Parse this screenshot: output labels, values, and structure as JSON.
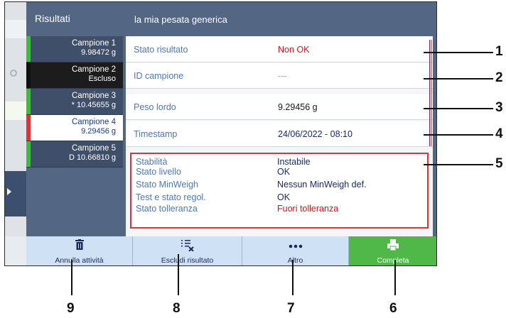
{
  "header": {
    "left_title": "Risultati",
    "right_title": "la mia pesata generica"
  },
  "samples": [
    {
      "name": "Campione 1",
      "value": "9.98472 g",
      "bar_color": "#3dbb3d",
      "state": "normal"
    },
    {
      "name": "Campione 2",
      "value": "Escluso",
      "bar_color": "#111111",
      "state": "excluded"
    },
    {
      "name": "Campione 3",
      "value": "* 10.45655 g",
      "bar_color": "#3dbb3d",
      "state": "normal"
    },
    {
      "name": "Campione 4",
      "value": "9.29456 g",
      "bar_color": "#e03138",
      "state": "active"
    },
    {
      "name": "Campione 5",
      "value": "D 10.66810 g",
      "bar_color": "#3dbb3d",
      "state": "normal"
    }
  ],
  "details": [
    {
      "label": "Stato risultato",
      "value": "Non OK",
      "value_color": "red"
    },
    {
      "label": "ID campione",
      "value": "---",
      "value_color": "gray"
    },
    {
      "label": "Peso lordo",
      "value": "9.29456 g",
      "value_color": "normal"
    },
    {
      "label": "Timestamp",
      "value": "24/06/2022 - 08:10",
      "value_color": "normal"
    }
  ],
  "status": [
    {
      "label": "Stabilità",
      "value": "Instabile",
      "value_color": "normal"
    },
    {
      "label": "Stato livello",
      "value": "OK",
      "value_color": "normal"
    },
    {
      "label": "Stato MinWeigh",
      "value": "Nessun MinWeigh def.",
      "value_color": "normal"
    },
    {
      "label": "Test e stato regol.",
      "value": "OK",
      "value_color": "normal"
    },
    {
      "label": "Stato tolleranza",
      "value": "Fuori tolleranza",
      "value_color": "red"
    }
  ],
  "footer": [
    {
      "label": "Annulla attività",
      "icon": "trash-icon"
    },
    {
      "label": "Escludi risultato",
      "icon": "exclude-list-icon"
    },
    {
      "label": "Altro",
      "icon": "more-icon"
    },
    {
      "label": "Completa",
      "icon": "printer-icon"
    }
  ],
  "callouts": [
    "1",
    "2",
    "3",
    "4",
    "5",
    "6",
    "7",
    "8",
    "9"
  ],
  "colors": {
    "header": "#536684",
    "accent_green": "#4fb848",
    "error_red": "#e03138"
  }
}
